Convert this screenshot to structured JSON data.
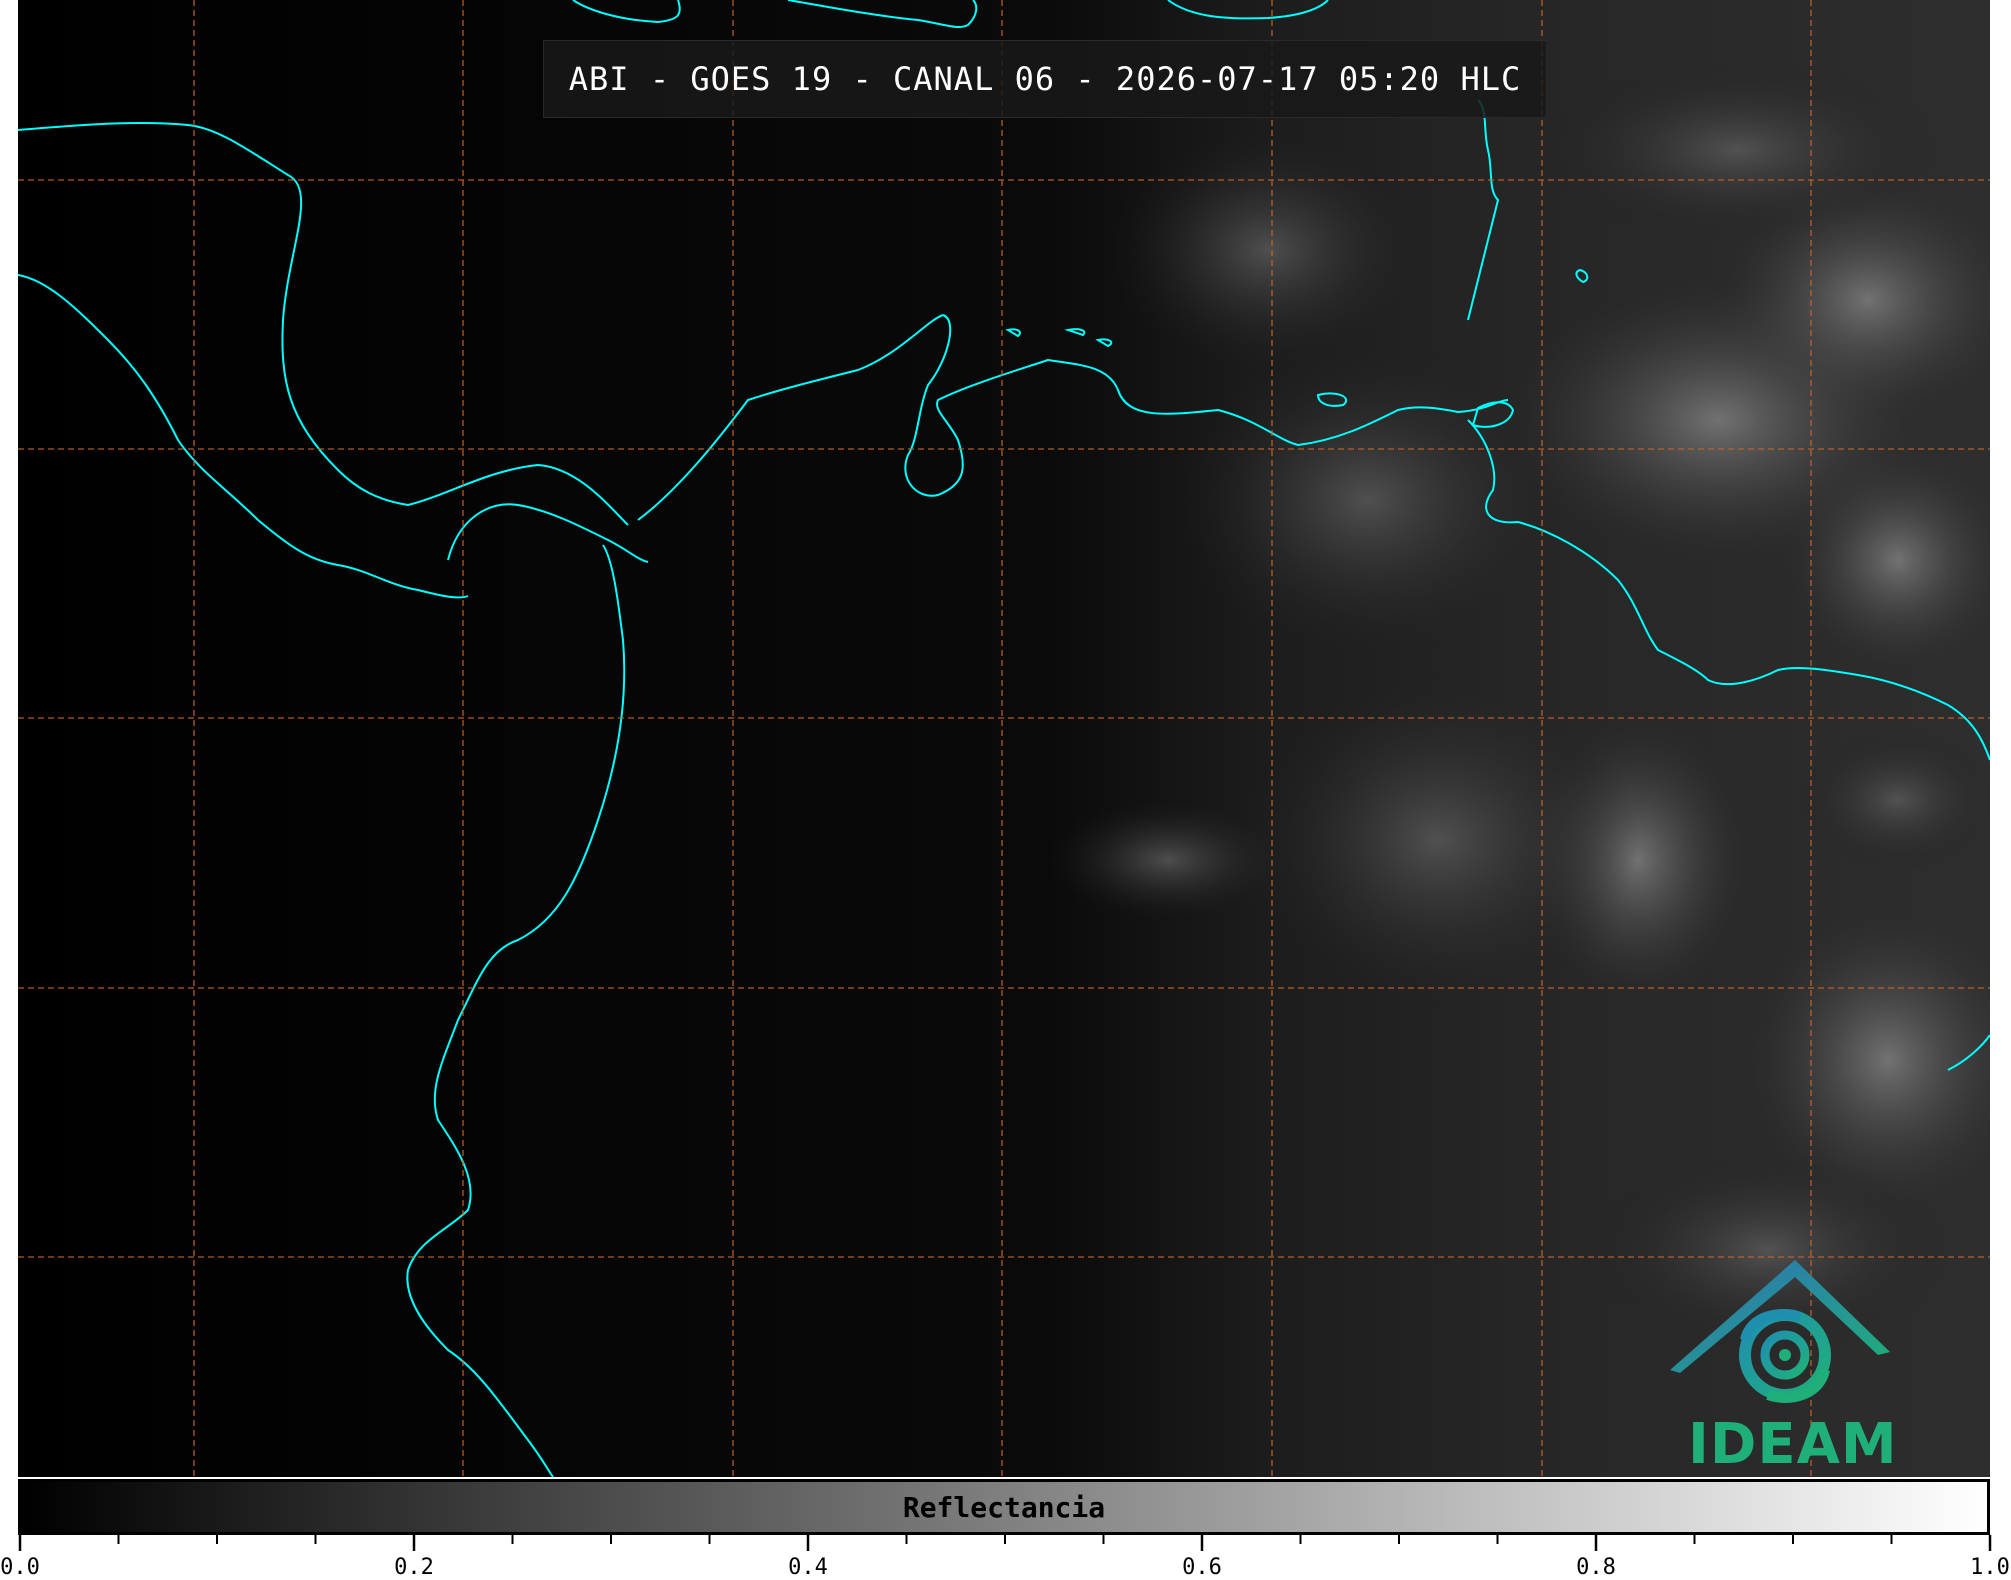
{
  "title": "ABI - GOES 19 - CANAL 06 - 2026-07-17 05:20 HLC",
  "colorbar": {
    "label": "Reflectancia",
    "min": 0.0,
    "max": 1.0,
    "tick_labels": [
      "0.0",
      "0.2",
      "0.4",
      "0.6",
      "0.8",
      "1.0"
    ],
    "colormap": [
      "#000000",
      "#ffffff"
    ]
  },
  "logo": {
    "text": "IDEAM",
    "color": "#1fb07a"
  },
  "colors": {
    "coastline": "#00ffff",
    "gridlines": "#c8642a",
    "background": "#000000"
  }
}
